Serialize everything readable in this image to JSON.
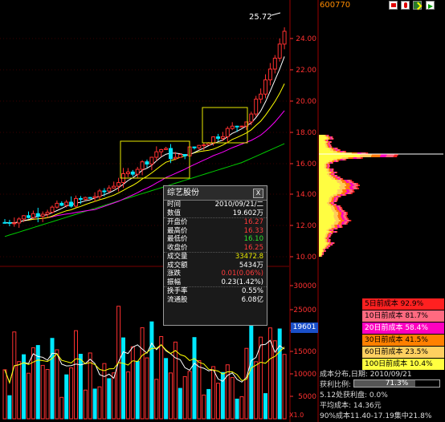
{
  "stock_code": "600770",
  "high_marker": "25.72",
  "price_axis": [
    "24.00",
    "22.00",
    "20.00",
    "18.00",
    "16.00",
    "14.00",
    "12.00",
    "10.00"
  ],
  "volume_axis": [
    "30000",
    "25000",
    "20000",
    "15000",
    "10000",
    "5000"
  ],
  "volume_unit": "X1.0",
  "volume_tag": "19601",
  "popup": {
    "title": "综艺股份",
    "close": "X",
    "rows": [
      {
        "label": "时间",
        "value": "2010/09/21/二",
        "color": "#ffffff"
      },
      {
        "label": "数值",
        "value": "19.602万",
        "color": "#ffffff"
      },
      {
        "label": "开盘价",
        "value": "16.27",
        "color": "#ff3b3b"
      },
      {
        "label": "最高价",
        "value": "16.33",
        "color": "#ff3b3b"
      },
      {
        "label": "最低价",
        "value": "16.10",
        "color": "#2ee22e"
      },
      {
        "label": "收盘价",
        "value": "16.25",
        "color": "#ff3b3b"
      },
      {
        "label": "成交量",
        "value": "33472.8",
        "color": "#e8e800"
      },
      {
        "label": "成交额",
        "value": "5434万",
        "color": "#ffffff"
      },
      {
        "label": "涨跌",
        "value": "0.01(0.06%)",
        "color": "#ff3b3b"
      },
      {
        "label": "振幅",
        "value": "0.23(1.42%)",
        "color": "#ffffff"
      },
      {
        "label": "换手率",
        "value": "0.55%",
        "color": "#ffffff"
      },
      {
        "label": "流通股",
        "value": "6.08亿",
        "color": "#ffffff"
      }
    ]
  },
  "cost_legend": [
    {
      "label": "5日前成本 92.9%",
      "bg": "#ff2020",
      "fg": "#000000"
    },
    {
      "label": "10日前成本 81.7%",
      "bg": "#ff6a80",
      "fg": "#000000"
    },
    {
      "label": "20日前成本 58.4%",
      "bg": "#ff00c0",
      "fg": "#ffffff"
    },
    {
      "label": "30日前成本 41.5%",
      "bg": "#ff8000",
      "fg": "#000000"
    },
    {
      "label": "60日前成本 23.5%",
      "bg": "#ffd060",
      "fg": "#000000"
    },
    {
      "label": "100日前成本 10.4%",
      "bg": "#ffff40",
      "fg": "#000000"
    }
  ],
  "cost_info": {
    "dist_date": "成本分布,日期: 2010/09/21",
    "profit_label": "获利比例:",
    "profit_value": "71.3%",
    "avg_line": "5.12处获利盘: 0.0%",
    "avg_cost": "平均成本: 14.36元",
    "concentration": "90%成本11.40-17.19集中21.8%"
  },
  "colors": {
    "up_candle": "#ff3030",
    "down_candle": "#00e8ff",
    "ma5": "#ffffff",
    "ma10": "#ffff00",
    "ma20": "#ff00ff",
    "ma60": "#00cc00",
    "vol_bar_up": "#ff3030",
    "vol_bar_down": "#00e8ff"
  }
}
